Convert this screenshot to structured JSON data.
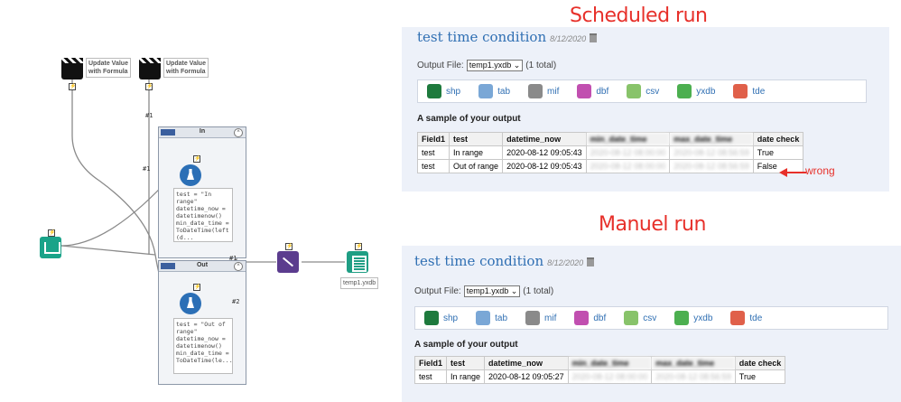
{
  "workflow": {
    "formula_tools": [
      {
        "label": "Update Value\nwith Formula"
      },
      {
        "label": "Update Value\nwith Formula"
      }
    ],
    "containers": [
      {
        "title": "In",
        "collapse": "^",
        "annotation": "test = \"In range\"\ndatetime_now =\ndatetimenow()\nmin_date_time =\nToDateTime(left\n(d..."
      },
      {
        "title": "Out",
        "collapse": "^",
        "annotation": "test = \"Out of\nrange\"\ndatetime_now =\ndatetimenow()\nmin_date_time =\nToDateTime(le..."
      }
    ],
    "connection_labels": {
      "c1": "#1",
      "c2": "#1",
      "c3": "#1",
      "c4": "#2"
    },
    "output_tool": {
      "label": "temp1.yxdb"
    },
    "bolt": "⚡"
  },
  "scheduled": {
    "heading": "Scheduled run",
    "title": "test time condition",
    "date": "8/12/2020",
    "output_file_label": "Output File:",
    "output_file_value": "temp1.yxdb ⌄",
    "total": "(1 total)",
    "formats": [
      "shp",
      "tab",
      "mif",
      "dbf",
      "csv",
      "yxdb",
      "tde"
    ],
    "sample_label": "A sample of your output",
    "columns": [
      "Field1",
      "test",
      "datetime_now",
      "min_date_time",
      "max_date_time",
      "date check"
    ],
    "rows": [
      [
        "test",
        "In range",
        "2020-08-12 09:05:43",
        "2020-08-12 08:00:00",
        "2020-08-12 08:56:59",
        "True"
      ],
      [
        "test",
        "Out of range",
        "2020-08-12 09:05:43",
        "2020-08-12 08:00:00",
        "2020-08-12 08:56:59",
        "False"
      ]
    ],
    "annotation": "wrong"
  },
  "manual": {
    "heading": "Manuel run",
    "title": "test time condition",
    "date": "8/12/2020",
    "output_file_label": "Output File:",
    "output_file_value": "temp1.yxdb ⌄",
    "total": "(1 total)",
    "formats": [
      "shp",
      "tab",
      "mif",
      "dbf",
      "csv",
      "yxdb",
      "tde"
    ],
    "sample_label": "A sample of your output",
    "columns": [
      "Field1",
      "test",
      "datetime_now",
      "min_date_time",
      "max_date_time",
      "date check"
    ],
    "rows": [
      [
        "test",
        "In range",
        "2020-08-12 09:05:27",
        "2020-08-12 08:00:00",
        "2020-08-12 08:56:59",
        "True"
      ]
    ]
  },
  "colors": {
    "heading": "#e7302a",
    "link": "#2f6fb3",
    "panel_bg": "#edf1f9"
  }
}
